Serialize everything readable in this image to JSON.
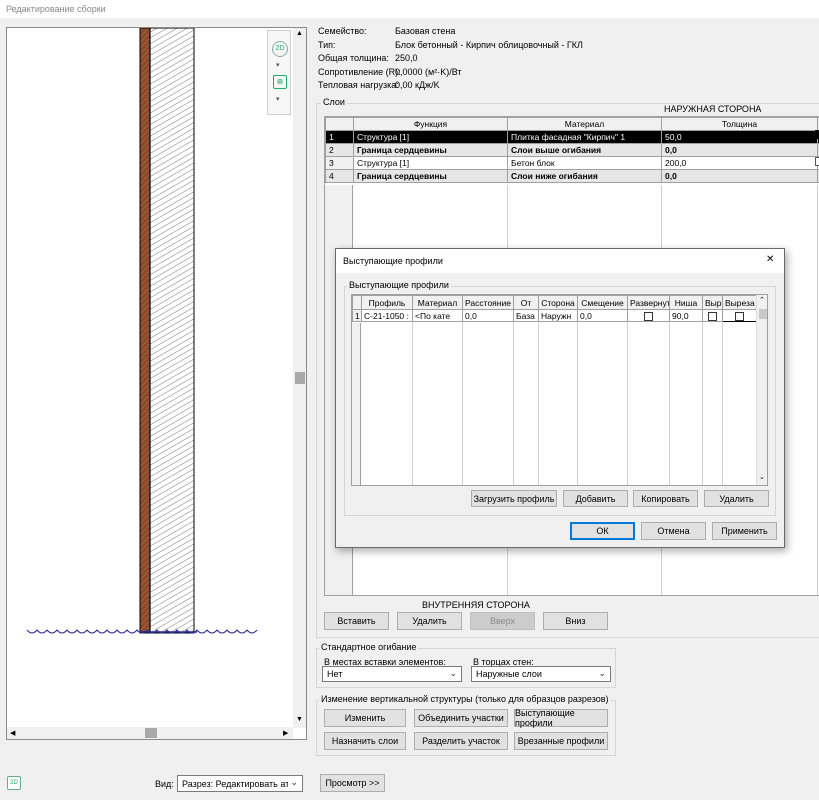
{
  "window": {
    "title": "Редактирование сборки"
  },
  "properties": [
    {
      "label": "Семейство:",
      "value": "Базовая стена"
    },
    {
      "label": "Тип:",
      "value": "Блок бетонный - Кирпич облицовочный - ГКЛ"
    },
    {
      "label": "Общая толщина:",
      "value": "250,0"
    },
    {
      "label": "Сопротивление (R):",
      "value": "0,0000 (м²·K)/Вт"
    },
    {
      "label": "Тепловая нагрузка:",
      "value": "0,00 кДж/K"
    }
  ],
  "layers": {
    "group_label": "Слои",
    "exterior_label": "НАРУЖНАЯ СТОРОНА",
    "interior_label": "ВНУТРЕННЯЯ СТОРОНА",
    "columns": [
      "Функция",
      "Материал",
      "Толщина"
    ],
    "rows": [
      {
        "num": "1",
        "function": "Структура [1]",
        "material": "Плитка фасадная \"Кирпич\" 1",
        "thickness": "50,0"
      },
      {
        "num": "2",
        "function": "Граница сердцевины",
        "material": "Слои выше огибания",
        "thickness": "0,0"
      },
      {
        "num": "3",
        "function": "Структура [1]",
        "material": "Бетон блок",
        "thickness": "200,0"
      },
      {
        "num": "4",
        "function": "Граница сердцевины",
        "material": "Слои ниже огибания",
        "thickness": "0,0"
      }
    ],
    "buttons": {
      "insert": "Вставить",
      "delete": "Удалить",
      "up": "Вверх",
      "down": "Вниз"
    }
  },
  "wrapping": {
    "group_label": "Стандартное огибание",
    "insert_label": "В местах вставки элементов:",
    "insert_value": "Нет",
    "ends_label": "В торцах стен:",
    "ends_value": "Наружные слои"
  },
  "vertical": {
    "group_label": "Изменение вертикальной структуры (только для образцов разрезов)",
    "buttons": {
      "modify": "Изменить",
      "merge": "Объединить участки",
      "sweeps": "Выступающие профили",
      "assign": "Назначить слои",
      "split": "Разделить участок",
      "reveals": "Врезанные профили"
    }
  },
  "footer": {
    "view_label": "Вид:",
    "view_value": "Разрез: Редактировать атри",
    "preview_button": "Просмотр >>"
  },
  "dialog": {
    "title": "Выступающие профили",
    "close": "✕",
    "group_label": "Выступающие профили",
    "columns": [
      "Профиль",
      "Материал",
      "Расстояние",
      "От",
      "Сторона",
      "Смещение",
      "Развернут",
      "Ниша",
      "Выр",
      "Выреза"
    ],
    "rows": [
      {
        "num": "1",
        "profile": "С-21-1050 :",
        "material": "<По кате",
        "distance": "0,0",
        "from": "База",
        "side": "Наружн",
        "offset": "0,0",
        "flipped": false,
        "setback": "90,0",
        "cuts": false,
        "cuttable": false
      }
    ],
    "buttons": {
      "load": "Загрузить профиль",
      "add": "Добавить",
      "copy": "Копировать",
      "delete": "Удалить",
      "ok": "ОК",
      "cancel": "Отмена",
      "apply": "Применить"
    }
  },
  "colors": {
    "brick": "#8b4a2f",
    "dialog_border": "#6a6a6a",
    "selection": "#000000",
    "accent": "#0078d7",
    "grade_line": "#2a2a8a"
  },
  "icons": [
    "zoom-2d-icon",
    "zoom-region-icon",
    "view-cube-icon"
  ]
}
